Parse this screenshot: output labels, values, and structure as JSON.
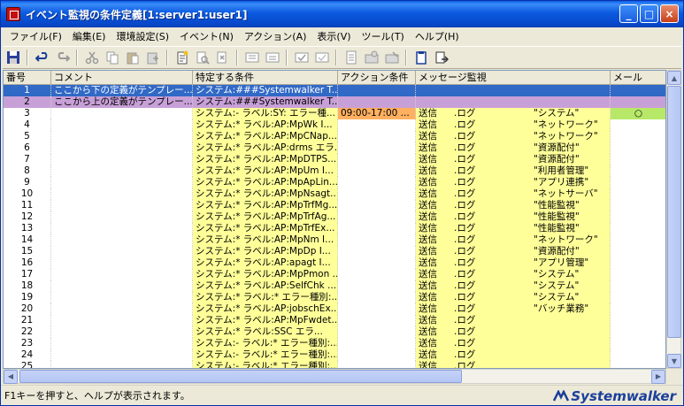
{
  "window": {
    "title": "イベント監視の条件定義[1:server1:user1]",
    "minimize": "_",
    "maximize": "□",
    "close": "×"
  },
  "menu": [
    "ファイル(F)",
    "編集(E)",
    "環境設定(S)",
    "イベント(N)",
    "アクション(A)",
    "表示(V)",
    "ツール(T)",
    "ヘルプ(H)"
  ],
  "table": {
    "headers": {
      "no": "番号",
      "comment": "コメント",
      "spec": "特定する条件",
      "action": "アクション条件",
      "msg": "メッセージ監視",
      "mail": "メール"
    },
    "rows": [
      {
        "no": "1",
        "comment": "ここから下の定義がテンプレー...",
        "spec": "システム:###Systemwalker T...",
        "action": "",
        "msg_a": "",
        "msg_b": "",
        "msg_c": "",
        "mail": "",
        "style": "sel-blue"
      },
      {
        "no": "2",
        "comment": "ここから上の定義がテンプレー...",
        "spec": "システム:###Systemwalker T...",
        "action": "",
        "msg_a": "",
        "msg_b": "",
        "msg_c": "",
        "mail": "",
        "style": "sel-purple"
      },
      {
        "no": "3",
        "comment": "",
        "spec": "システム:- ラベル:SY: エラー種...",
        "action": "09:00-17:00 ...",
        "msg_a": "送信",
        "msg_b": ".ログ",
        "msg_c": "\"システム\"",
        "mail": "○",
        "style": "hilite"
      },
      {
        "no": "4",
        "comment": "",
        "spec": "システム:* ラベル:AP:MpWk I...",
        "action": "",
        "msg_a": "送信",
        "msg_b": ".ログ",
        "msg_c": "\"ネットワーク\"",
        "mail": "",
        "style": ""
      },
      {
        "no": "5",
        "comment": "",
        "spec": "システム:* ラベル:AP:MpCNap...",
        "action": "",
        "msg_a": "送信",
        "msg_b": ".ログ",
        "msg_c": "\"ネットワーク\"",
        "mail": "",
        "style": ""
      },
      {
        "no": "6",
        "comment": "",
        "spec": "システム:* ラベル:AP:drms エラ...",
        "action": "",
        "msg_a": "送信",
        "msg_b": ".ログ",
        "msg_c": "\"資源配付\"",
        "mail": "",
        "style": ""
      },
      {
        "no": "7",
        "comment": "",
        "spec": "システム:* ラベル:AP:MpDTPS...",
        "action": "",
        "msg_a": "送信",
        "msg_b": ".ログ",
        "msg_c": "\"資源配付\"",
        "mail": "",
        "style": ""
      },
      {
        "no": "8",
        "comment": "",
        "spec": "システム:* ラベル:AP:MpUm I...",
        "action": "",
        "msg_a": "送信",
        "msg_b": ".ログ",
        "msg_c": "\"利用者管理\"",
        "mail": "",
        "style": ""
      },
      {
        "no": "9",
        "comment": "",
        "spec": "システム:* ラベル:AP:MpApLin...",
        "action": "",
        "msg_a": "送信",
        "msg_b": ".ログ",
        "msg_c": "\"アプリ連携\"",
        "mail": "",
        "style": ""
      },
      {
        "no": "10",
        "comment": "",
        "spec": "システム:* ラベル:AP:MpNsagt...",
        "action": "",
        "msg_a": "送信",
        "msg_b": ".ログ",
        "msg_c": "\"ネットサーバ\"",
        "mail": "",
        "style": ""
      },
      {
        "no": "11",
        "comment": "",
        "spec": "システム:* ラベル:AP:MpTrfMg...",
        "action": "",
        "msg_a": "送信",
        "msg_b": ".ログ",
        "msg_c": "\"性能監視\"",
        "mail": "",
        "style": ""
      },
      {
        "no": "12",
        "comment": "",
        "spec": "システム:* ラベル:AP:MpTrfAg...",
        "action": "",
        "msg_a": "送信",
        "msg_b": ".ログ",
        "msg_c": "\"性能監視\"",
        "mail": "",
        "style": ""
      },
      {
        "no": "13",
        "comment": "",
        "spec": "システム:* ラベル:AP:MpTrfEx...",
        "action": "",
        "msg_a": "送信",
        "msg_b": ".ログ",
        "msg_c": "\"性能監視\"",
        "mail": "",
        "style": ""
      },
      {
        "no": "14",
        "comment": "",
        "spec": "システム:* ラベル:AP:MpNm I...",
        "action": "",
        "msg_a": "送信",
        "msg_b": ".ログ",
        "msg_c": "\"ネットワーク\"",
        "mail": "",
        "style": ""
      },
      {
        "no": "15",
        "comment": "",
        "spec": "システム:* ラベル:AP:MpDp I...",
        "action": "",
        "msg_a": "送信",
        "msg_b": ".ログ",
        "msg_c": "\"資源配付\"",
        "mail": "",
        "style": ""
      },
      {
        "no": "16",
        "comment": "",
        "spec": "システム:* ラベル:AP:apagt I...",
        "action": "",
        "msg_a": "送信",
        "msg_b": ".ログ",
        "msg_c": "\"アプリ管理\"",
        "mail": "",
        "style": ""
      },
      {
        "no": "17",
        "comment": "",
        "spec": "システム:* ラベル:AP:MpPmon ...",
        "action": "",
        "msg_a": "送信",
        "msg_b": ".ログ",
        "msg_c": "\"システム\"",
        "mail": "",
        "style": ""
      },
      {
        "no": "18",
        "comment": "",
        "spec": "システム:* ラベル:AP:SelfChk ...",
        "action": "",
        "msg_a": "送信",
        "msg_b": ".ログ",
        "msg_c": "\"システム\"",
        "mail": "",
        "style": ""
      },
      {
        "no": "19",
        "comment": "",
        "spec": "システム:* ラベル:* エラー種別:...",
        "action": "",
        "msg_a": "送信",
        "msg_b": ".ログ",
        "msg_c": "\"システム\"",
        "mail": "",
        "style": ""
      },
      {
        "no": "20",
        "comment": "",
        "spec": "システム:* ラベル:AP:jobschEx...",
        "action": "",
        "msg_a": "送信",
        "msg_b": ".ログ",
        "msg_c": "\"バッチ業務\"",
        "mail": "",
        "style": ""
      },
      {
        "no": "21",
        "comment": "",
        "spec": "システム:* ラベル:AP:MpFwdet...",
        "action": "",
        "msg_a": "送信",
        "msg_b": ".ログ",
        "msg_c": "",
        "mail": "",
        "style": ""
      },
      {
        "no": "22",
        "comment": "",
        "spec": "システム:* ラベル:SSC エラ...",
        "action": "",
        "msg_a": "送信",
        "msg_b": ".ログ",
        "msg_c": "",
        "mail": "",
        "style": ""
      },
      {
        "no": "23",
        "comment": "",
        "spec": "システム:- ラベル:* エラー種別:...",
        "action": "",
        "msg_a": "送信",
        "msg_b": ".ログ",
        "msg_c": "",
        "mail": "",
        "style": ""
      },
      {
        "no": "24",
        "comment": "",
        "spec": "システム:- ラベル:* エラー種別:...",
        "action": "",
        "msg_a": "送信",
        "msg_b": ".ログ",
        "msg_c": "",
        "mail": "",
        "style": ""
      },
      {
        "no": "25",
        "comment": "",
        "spec": "システム:- ラベル:* エラー種別:...",
        "action": "",
        "msg_a": "送信",
        "msg_b": ".ログ",
        "msg_c": "",
        "mail": "",
        "style": ""
      }
    ]
  },
  "statusbar": {
    "text": "F1キーを押すと、ヘルプが表示されます。",
    "brand": "Systemwalker"
  },
  "colors": {
    "title_bar": "#0a5ce8",
    "selected_row": "#3169c6",
    "template_row": "#c8a0d8",
    "condition_column": "#ffff99",
    "action_highlight": "#ffb060",
    "mail_highlight": "#b8e868",
    "brand": "#1a3f9c"
  }
}
